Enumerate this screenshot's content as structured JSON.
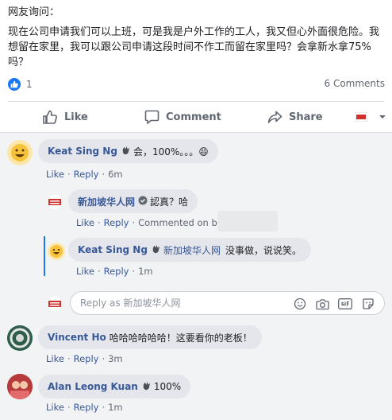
{
  "post": {
    "heading": "网友询问：",
    "body": "现在公司申请我们可以上班，可是我是户外工作的工人，我又但心外面很危险。我想留在家里，我可以跟公司申请这段时间不作工而留在家里吗？会拿新水拿75%吗？"
  },
  "reactions": {
    "like_count": "1",
    "comments_label": "6 Comments"
  },
  "actions": {
    "like": "Like",
    "comment": "Comment",
    "share": "Share"
  },
  "colors": {
    "brand": "#1877f2",
    "link": "#385898",
    "bubble": "#e4e6eb",
    "thread_line": "#1877f2"
  },
  "comments": [
    {
      "author": "Keat Sing Ng",
      "text": "会，100%。。。😄",
      "like": "Like",
      "reply": "Reply",
      "time": "6m",
      "replies": [
        {
          "author": "新加坡华人网",
          "text": "認真？哈",
          "like": "Like",
          "reply": "Reply",
          "time": "Commented on by"
        },
        {
          "author": "Keat Sing Ng",
          "mention": "新加坡华人网",
          "text": "没事做，说说笑。",
          "like": "Like",
          "reply": "Reply",
          "time": "1m"
        }
      ]
    },
    {
      "author": "Vincent Ho",
      "text": "哈哈哈哈哈哈！这要看你的老板！",
      "like": "Like",
      "reply": "Reply",
      "time": "3m"
    },
    {
      "author": "Alan Leong Kuan",
      "text": "100%",
      "like": "Like",
      "reply": "Reply",
      "time": "1m"
    }
  ],
  "reply_box": {
    "placeholder": "Reply as 新加坡华人网"
  }
}
